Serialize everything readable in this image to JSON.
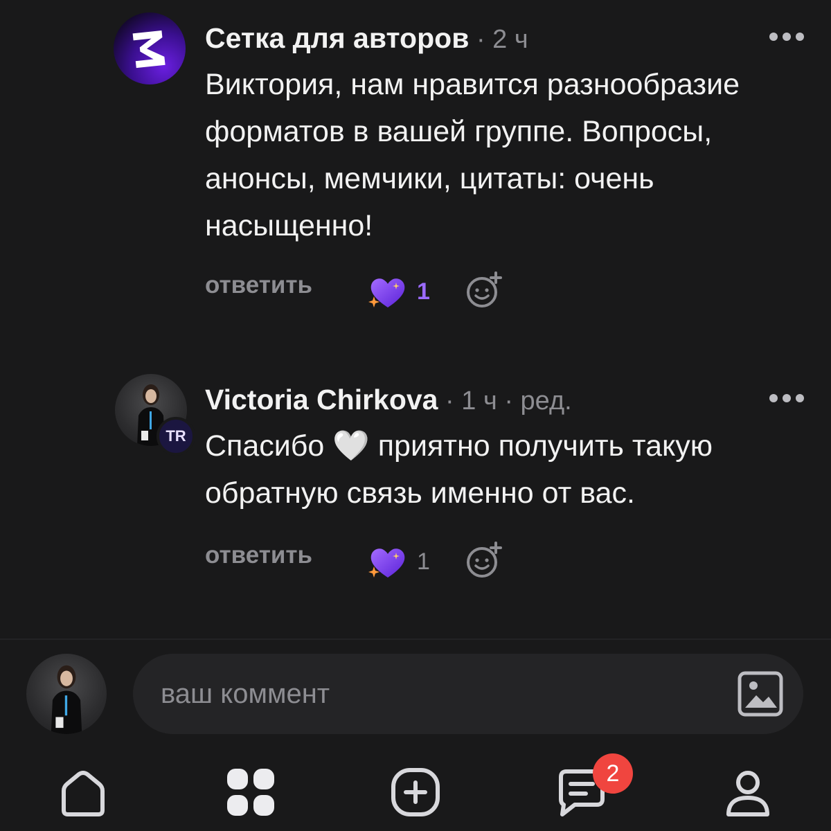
{
  "comments": [
    {
      "author": "Сетка для авторов",
      "meta": " · 2 ч",
      "text": "Виктория, нам нравится разнообразие форматов в вашей группе. Вопросы, анонсы, мемчики, цитаты: очень насыщенно!",
      "reply_label": "ответить",
      "reaction_count": "1",
      "reaction_count_color": "#9b6bff",
      "avatar_icon": "brand-logo-icon"
    },
    {
      "author": "Victoria Chirkova",
      "meta": " · 1 ч · ред.",
      "text_before": "Спасибо ",
      "text_emoji": "🤍",
      "text_after": " приятно получить такую обратную связь именно от вас.",
      "badge_text": "TR",
      "reply_label": "ответить",
      "reaction_count": "1",
      "reaction_count_color": "#8d8d92",
      "avatar_icon": "user-photo-avatar"
    }
  ],
  "composer": {
    "placeholder": "ваш коммент",
    "attach_icon": "image-icon"
  },
  "tabbar": {
    "items": [
      "home-icon",
      "apps-grid-icon",
      "add-post-icon",
      "messages-icon",
      "profile-icon"
    ],
    "messages_badge": "2"
  },
  "colors": {
    "background": "#19191a",
    "accent_purple": "#7b3cff",
    "badge_red": "#f0453f",
    "muted_text": "#8d8d92"
  }
}
